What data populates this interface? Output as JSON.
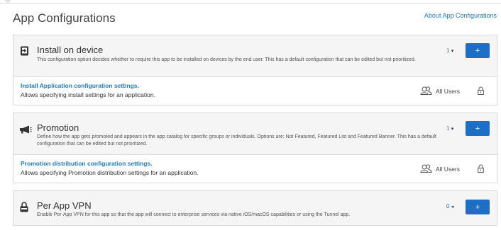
{
  "page": {
    "title": "App Configurations",
    "about_link": "About App Configurations"
  },
  "sections": [
    {
      "title": "Install on device",
      "icon": "install-device-icon",
      "description": "This configuration option decides whether to require this app to be installed on devices by the end user. This has a default configuration that can be edited but not prioritized.",
      "count": "1",
      "add_label": "+",
      "row": {
        "link": "Install Application configuration settings.",
        "desc": "Allows specifying install settings for an application.",
        "users": "All Users"
      }
    },
    {
      "title": "Promotion",
      "icon": "megaphone-icon",
      "description": "Define how the app gets promoted and appears in the app catalog for specific groups or individuals. Options are: Not Featured, Featured List and Featured Banner. This has a default configuration that can be edited but not prioritized.",
      "count": "1",
      "add_label": "+",
      "row": {
        "link": "Promotion distribution configuration settings.",
        "desc": "Allows specifying Promotion distribution settings for an application.",
        "users": "All Users"
      }
    },
    {
      "title": "Per App VPN",
      "icon": "vpn-lock-icon",
      "description": "Enable Per-App VPN for this app so that the app will connect to enterprise services via native iOS/macOS capabilities or using the Tunnel app.",
      "count": "0",
      "add_label": "+"
    }
  ],
  "colors": {
    "accent": "#1c6fc4",
    "link": "#1d7ac7",
    "header_bg": "#f5f5f5",
    "border": "#d9d9d9"
  }
}
